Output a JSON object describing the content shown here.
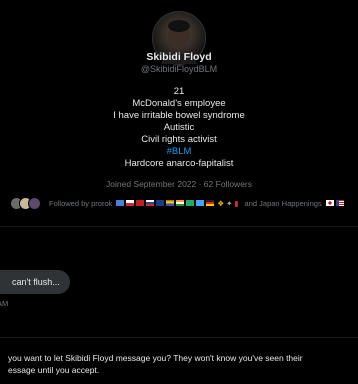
{
  "profile": {
    "name": "Skibidi Floyd",
    "handle": "@SkibidiFloydBLM",
    "bio_lines": [
      "21",
      "McDonald’s employee",
      "I have irritable bowel syndrome",
      "Autistic",
      "Civil rights activist"
    ],
    "hashtag": "#BLM",
    "bio_last": "Hardcore anarco-fapitalist",
    "joined": "Joined September 2022 · 62 Followers",
    "followed_by_prefix": "Followed by prorok",
    "followed_by_suffix": "and Japan Happenings"
  },
  "conversation": {
    "message_text": "can't flush...",
    "message_time": "AM"
  },
  "request": {
    "line1": "you want to let Skibidi Floyd message you? They won't know you've seen their",
    "line2": "essage until you accept."
  },
  "colors": {
    "accent": "#1d9bf0",
    "muted": "#71767b",
    "bubble": "#2f3336"
  }
}
